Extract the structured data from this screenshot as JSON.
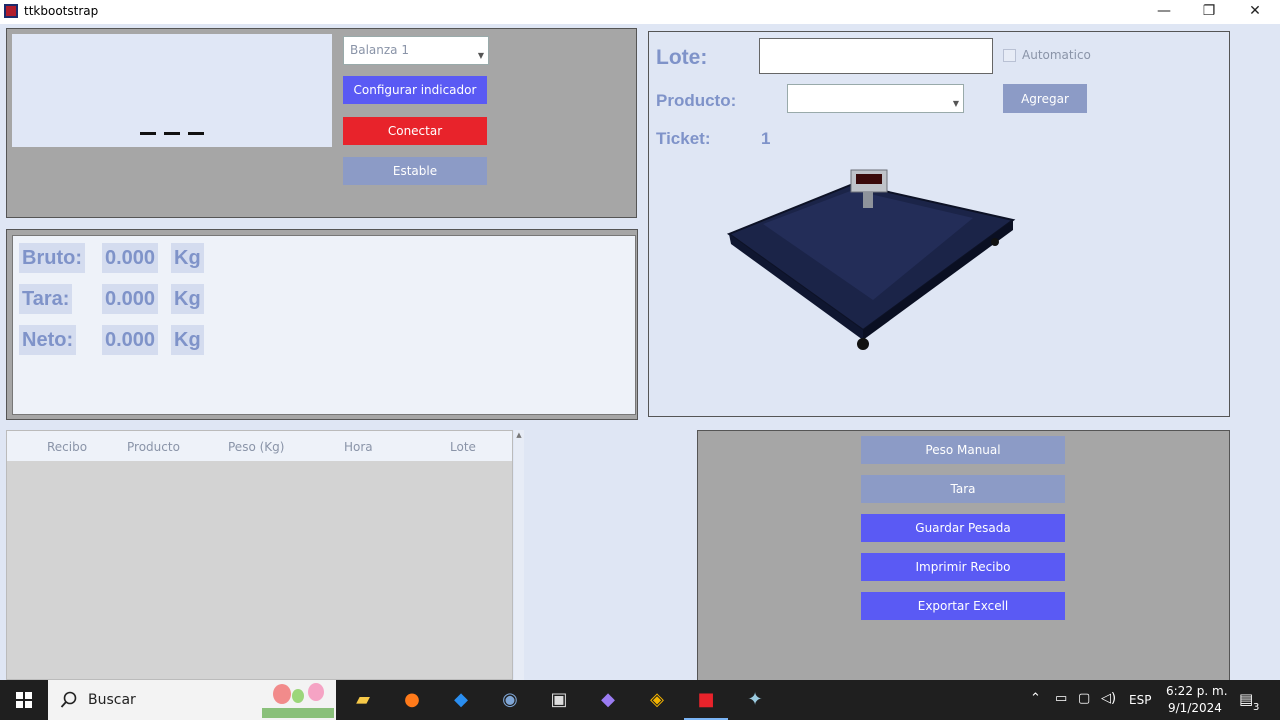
{
  "window": {
    "title": "ttkbootstrap",
    "minimize": "—",
    "maximize": "❐",
    "close": "✕"
  },
  "scale_panel": {
    "scale_select": "Balanza 1",
    "configure_label": "Configurar indicador",
    "connect_label": "Conectar",
    "status_label": "Estable"
  },
  "weights": {
    "gross_label": "Bruto:",
    "gross_value": "0.000",
    "gross_unit": "Kg",
    "tare_label": "Tara:",
    "tare_value": "0.000",
    "tare_unit": "Kg",
    "net_label": "Neto:",
    "net_value": "0.000",
    "net_unit": "Kg"
  },
  "form": {
    "lot_label": "Lote:",
    "lot_value": "",
    "auto_label": "Automatico",
    "auto_checked": false,
    "product_label": "Producto:",
    "product_value": "",
    "add_label": "Agregar",
    "ticket_label": "Ticket:",
    "ticket_value": "1"
  },
  "table": {
    "columns": [
      "Recibo",
      "Producto",
      "Peso (Kg)",
      "Hora",
      "Lote"
    ],
    "rows": []
  },
  "actions": {
    "manual_weight": "Peso Manual",
    "tare": "Tara",
    "save_weighing": "Guardar Pesada",
    "print_receipt": "Imprimir Recibo",
    "export_excel": "Exportar Excell"
  },
  "taskbar": {
    "search_placeholder": "Buscar",
    "language": "ESP",
    "time": "6:22 p. m.",
    "date": "9/1/2024",
    "notifications": "3"
  },
  "colors": {
    "accent": "#5a5af4",
    "danger": "#e8232b",
    "muted": "#8c9bc6",
    "label": "#7f93c9"
  }
}
